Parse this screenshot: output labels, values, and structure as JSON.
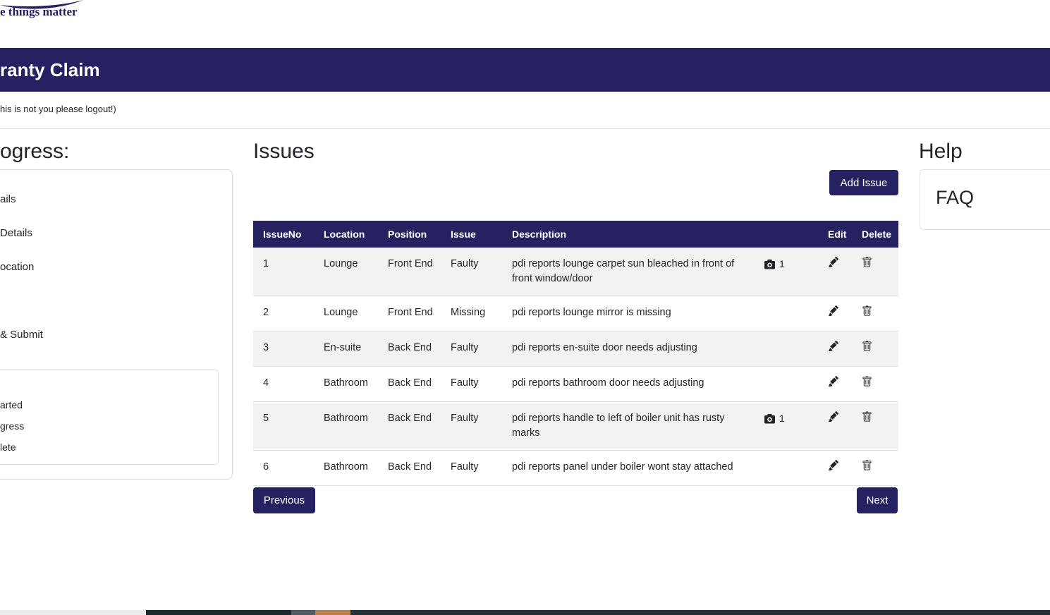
{
  "brand": {
    "tagline_fragment": "e things matter",
    "swoosh_icon": "logo-swoosh-icon"
  },
  "header": {
    "title_fragment": "ranty Claim"
  },
  "logout_note_fragment": "his is not you please logout!)",
  "progress": {
    "heading_fragment": "ogress:",
    "steps": [
      {
        "label_fragment": "ails"
      },
      {
        "label_fragment": "Details"
      },
      {
        "label_fragment": "ocation"
      },
      {
        "label_fragment": "& Submit"
      }
    ],
    "legend": [
      {
        "label_fragment": "arted"
      },
      {
        "label_fragment": "gress"
      },
      {
        "label_fragment": "lete"
      }
    ]
  },
  "issues": {
    "heading": "Issues",
    "add_button_label": "Add Issue",
    "table": {
      "headers": [
        "IssueNo",
        "Location",
        "Position",
        "Issue",
        "Description",
        "",
        "Edit",
        "Delete"
      ],
      "rows": [
        {
          "issueNo": "1",
          "location": "Lounge",
          "position": "Front End",
          "issue": "Faulty",
          "description": "pdi reports lounge carpet sun bleached in front of front window/door",
          "photos": "1"
        },
        {
          "issueNo": "2",
          "location": "Lounge",
          "position": "Front End",
          "issue": "Missing",
          "description": "pdi reports lounge mirror is missing",
          "photos": ""
        },
        {
          "issueNo": "3",
          "location": "En-suite",
          "position": "Back End",
          "issue": "Faulty",
          "description": "pdi reports en-suite door needs adjusting",
          "photos": ""
        },
        {
          "issueNo": "4",
          "location": "Bathroom",
          "position": "Back End",
          "issue": "Faulty",
          "description": "pdi reports bathroom door needs adjusting",
          "photos": ""
        },
        {
          "issueNo": "5",
          "location": "Bathroom",
          "position": "Back End",
          "issue": "Faulty",
          "description": "pdi reports handle to left of boiler unit has rusty marks",
          "photos": "1"
        },
        {
          "issueNo": "6",
          "location": "Bathroom",
          "position": "Back End",
          "issue": "Faulty",
          "description": "pdi reports panel under boiler wont stay attached",
          "photos": ""
        }
      ],
      "icons": {
        "edit": "pencil-icon",
        "delete": "trash-icon",
        "photos": "camera-icon"
      }
    },
    "pagination": {
      "previous_label": "Previous",
      "next_label": "Next"
    }
  },
  "help": {
    "heading": "Help",
    "faq_label": "FAQ"
  },
  "colors": {
    "navy": "#262160",
    "row_stripe": "#f2f2f2",
    "border": "#dee2e6",
    "footer_light": "#ececec",
    "footer_dark1": "#1b2a2c",
    "footer_slate": "#4d5c63",
    "footer_orange": "#b9824b",
    "footer_dark2": "#223236"
  }
}
